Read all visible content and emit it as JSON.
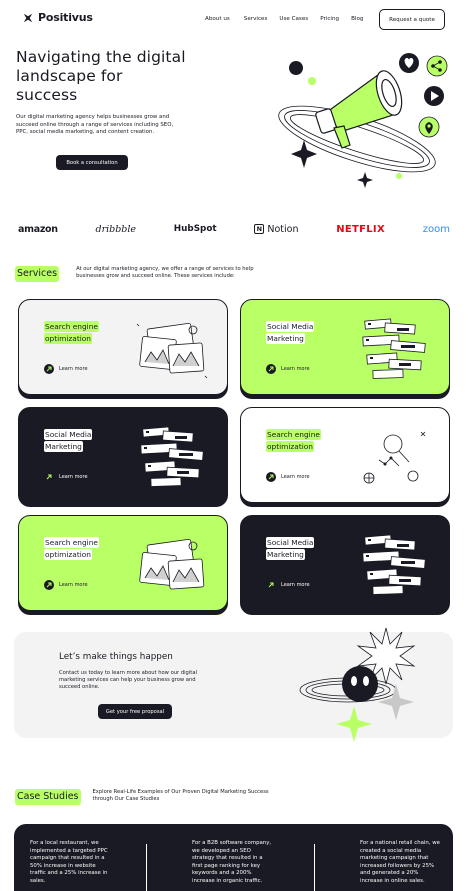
{
  "nav": {
    "brand": "Positivus",
    "links": [
      "About us",
      "Services",
      "Use Cases",
      "Pricing",
      "Blog"
    ],
    "cta": "Request a quote"
  },
  "hero": {
    "title": "Navigating the digital landscape for success",
    "text": "Our digital marketing agency helps businesses grow and succeed online through a range of services including SEO, PPC, social media marketing, and content creation.",
    "button": "Book a consultation"
  },
  "logos": {
    "amazon": "amazon",
    "dribbble": "dribbble",
    "hubspot": "HubSpot",
    "notion": "Notion",
    "notion_mark": "N",
    "netflix": "NETFLIX",
    "zoom": "zoom"
  },
  "services": {
    "label": "Services",
    "desc": "At our digital marketing agency, we offer a range of services to help businesses grow and succeed online. These services include:",
    "cards": [
      {
        "line1": "Search engine",
        "line2": "optimization",
        "link": "Learn more"
      },
      {
        "line1": "Social Media",
        "line2": "Marketing",
        "link": "Learn more"
      },
      {
        "line1": "Social Media",
        "line2": "Marketing",
        "link": "Learn more"
      },
      {
        "line1": "Search engine",
        "line2": "optimization",
        "link": "Learn more"
      },
      {
        "line1": "Search engine",
        "line2": "optimization",
        "link": "Learn more"
      },
      {
        "line1": "Social Media",
        "line2": "Marketing",
        "link": "Learn more"
      }
    ]
  },
  "cta": {
    "title": "Let’s make things happen",
    "text": "Contact us today to learn more about how our digital marketing services can help your business grow and succeed online.",
    "button": "Get your free proposal"
  },
  "case_studies": {
    "label": "Case Studies",
    "desc": "Explore Real-Life Examples of Our Proven Digital Marketing Success through Our Case Studies",
    "items": [
      "For a local restaurant, we implemented a targeted PPC campaign that resulted in a 50% increase in website traffic and a 25% increase in sales.",
      "For a B2B software company, we developed an SEO strategy that resulted in a first page ranking for key keywords and a 200% increase in organic traffic.",
      "For a national retail chain, we created a social media marketing campaign that increased followers by 25% and generated a 20% increase in online sales."
    ]
  },
  "colors": {
    "accent": "#B9FF66",
    "dark": "#191A23",
    "grey": "#F3F3F3"
  }
}
